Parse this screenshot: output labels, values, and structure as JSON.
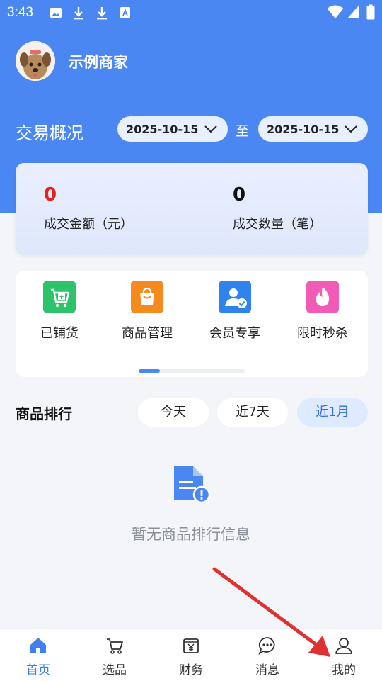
{
  "status_bar": {
    "time": "3:43"
  },
  "shop": {
    "name": "示例商家"
  },
  "overview": {
    "title": "交易概况",
    "start_date": "2025-10-15",
    "to_label": "至",
    "end_date": "2025-10-15"
  },
  "stats": [
    {
      "value": "0",
      "label": "成交金额（元）",
      "color": "#e8201a"
    },
    {
      "value": "0",
      "label": "成交数量（笔）",
      "color": "#111111"
    }
  ],
  "menu": [
    {
      "label": "已铺货",
      "icon": "cart-upload-icon",
      "color": "#2cc36b"
    },
    {
      "label": "商品管理",
      "icon": "shopping-bag-icon",
      "color": "#f58a1f"
    },
    {
      "label": "会员专享",
      "icon": "member-icon",
      "color": "#2f83ee"
    },
    {
      "label": "限时秒杀",
      "icon": "flame-icon",
      "color": "#f25bb5"
    }
  ],
  "ranking": {
    "title": "商品排行",
    "tabs": [
      "今天",
      "近7天",
      "近1月"
    ],
    "active_tab": "近1月",
    "empty_text": "暂无商品排行信息"
  },
  "bottom_nav": [
    {
      "label": "首页",
      "icon": "home-icon",
      "active": true
    },
    {
      "label": "选品",
      "icon": "cart-icon",
      "active": false
    },
    {
      "label": "财务",
      "icon": "finance-icon",
      "active": false
    },
    {
      "label": "消息",
      "icon": "message-icon",
      "active": false
    },
    {
      "label": "我的",
      "icon": "profile-icon",
      "active": false
    }
  ],
  "colors": {
    "primary": "#4a87f2",
    "accent_red": "#e03030"
  }
}
